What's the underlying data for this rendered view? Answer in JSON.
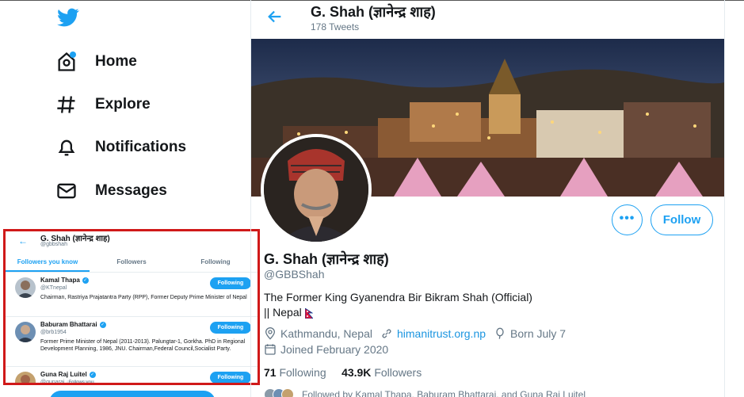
{
  "nav": {
    "items": [
      {
        "label": "Home",
        "icon": "home-icon"
      },
      {
        "label": "Explore",
        "icon": "hashtag-icon"
      },
      {
        "label": "Notifications",
        "icon": "bell-icon"
      },
      {
        "label": "Messages",
        "icon": "mail-icon"
      }
    ]
  },
  "overlay": {
    "name": "G. Shah (ज्ञानेन्द्र शाह)",
    "handle": "@gbbshah",
    "tabs": [
      "Followers you know",
      "Followers",
      "Following"
    ],
    "rows": [
      {
        "name": "Kamal Thapa",
        "handle": "@KTnepal",
        "bio": "Chairman, Rastriya Prajatantra Party (RPP), Former Deputy Prime Minister of Nepal",
        "button": "Following",
        "follows_you": ""
      },
      {
        "name": "Baburam Bhattarai",
        "handle": "@brb1954",
        "bio": "Former Prime Minister of Nepal (2011-2013). Palungtar-1, Gorkha. PhD in Regional Development Planning, 1986, JNU. Chairman,Federal Council,Socialist Party.",
        "button": "Following",
        "follows_you": ""
      },
      {
        "name": "Guna Raj Luitel",
        "handle": "@gunaraj",
        "bio": "",
        "button": "Following",
        "follows_you": "Follows you"
      }
    ]
  },
  "header": {
    "name": "G. Shah (ज्ञानेन्द्र शाह)",
    "tweet_count": "178 Tweets"
  },
  "profile": {
    "name": "G. Shah (ज्ञानेन्द्र शाह)",
    "handle": "@GBBShah",
    "bio_line1": "The Former King Gyanendra Bir Bikram Shah (Official)",
    "bio_line2": "|| Nepal",
    "location": "Kathmandu, Nepal",
    "website": "himanitrust.org.np",
    "born": "Born July 7",
    "joined": "Joined February 2020",
    "following_count": "71",
    "following_label": "Following",
    "followers_count": "43.9K",
    "followers_label": "Followers",
    "followed_by": "Followed by Kamal Thapa, Baburam Bhattarai, and Guna Raj Luitel"
  },
  "buttons": {
    "more": "•••",
    "follow": "Follow"
  },
  "colors": {
    "accent": "#1da1f2",
    "overlay_border": "#d01919"
  }
}
